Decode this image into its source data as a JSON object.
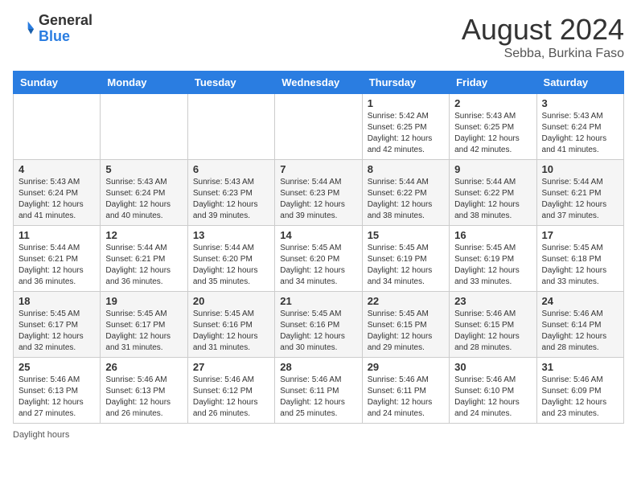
{
  "header": {
    "logo_general": "General",
    "logo_blue": "Blue",
    "month_title": "August 2024",
    "subtitle": "Sebba, Burkina Faso"
  },
  "weekdays": [
    "Sunday",
    "Monday",
    "Tuesday",
    "Wednesday",
    "Thursday",
    "Friday",
    "Saturday"
  ],
  "weeks": [
    [
      {
        "day": "",
        "info": ""
      },
      {
        "day": "",
        "info": ""
      },
      {
        "day": "",
        "info": ""
      },
      {
        "day": "",
        "info": ""
      },
      {
        "day": "1",
        "info": "Sunrise: 5:42 AM\nSunset: 6:25 PM\nDaylight: 12 hours and 42 minutes."
      },
      {
        "day": "2",
        "info": "Sunrise: 5:43 AM\nSunset: 6:25 PM\nDaylight: 12 hours and 42 minutes."
      },
      {
        "day": "3",
        "info": "Sunrise: 5:43 AM\nSunset: 6:24 PM\nDaylight: 12 hours and 41 minutes."
      }
    ],
    [
      {
        "day": "4",
        "info": "Sunrise: 5:43 AM\nSunset: 6:24 PM\nDaylight: 12 hours and 41 minutes."
      },
      {
        "day": "5",
        "info": "Sunrise: 5:43 AM\nSunset: 6:24 PM\nDaylight: 12 hours and 40 minutes."
      },
      {
        "day": "6",
        "info": "Sunrise: 5:43 AM\nSunset: 6:23 PM\nDaylight: 12 hours and 39 minutes."
      },
      {
        "day": "7",
        "info": "Sunrise: 5:44 AM\nSunset: 6:23 PM\nDaylight: 12 hours and 39 minutes."
      },
      {
        "day": "8",
        "info": "Sunrise: 5:44 AM\nSunset: 6:22 PM\nDaylight: 12 hours and 38 minutes."
      },
      {
        "day": "9",
        "info": "Sunrise: 5:44 AM\nSunset: 6:22 PM\nDaylight: 12 hours and 38 minutes."
      },
      {
        "day": "10",
        "info": "Sunrise: 5:44 AM\nSunset: 6:21 PM\nDaylight: 12 hours and 37 minutes."
      }
    ],
    [
      {
        "day": "11",
        "info": "Sunrise: 5:44 AM\nSunset: 6:21 PM\nDaylight: 12 hours and 36 minutes."
      },
      {
        "day": "12",
        "info": "Sunrise: 5:44 AM\nSunset: 6:21 PM\nDaylight: 12 hours and 36 minutes."
      },
      {
        "day": "13",
        "info": "Sunrise: 5:44 AM\nSunset: 6:20 PM\nDaylight: 12 hours and 35 minutes."
      },
      {
        "day": "14",
        "info": "Sunrise: 5:45 AM\nSunset: 6:20 PM\nDaylight: 12 hours and 34 minutes."
      },
      {
        "day": "15",
        "info": "Sunrise: 5:45 AM\nSunset: 6:19 PM\nDaylight: 12 hours and 34 minutes."
      },
      {
        "day": "16",
        "info": "Sunrise: 5:45 AM\nSunset: 6:19 PM\nDaylight: 12 hours and 33 minutes."
      },
      {
        "day": "17",
        "info": "Sunrise: 5:45 AM\nSunset: 6:18 PM\nDaylight: 12 hours and 33 minutes."
      }
    ],
    [
      {
        "day": "18",
        "info": "Sunrise: 5:45 AM\nSunset: 6:17 PM\nDaylight: 12 hours and 32 minutes."
      },
      {
        "day": "19",
        "info": "Sunrise: 5:45 AM\nSunset: 6:17 PM\nDaylight: 12 hours and 31 minutes."
      },
      {
        "day": "20",
        "info": "Sunrise: 5:45 AM\nSunset: 6:16 PM\nDaylight: 12 hours and 31 minutes."
      },
      {
        "day": "21",
        "info": "Sunrise: 5:45 AM\nSunset: 6:16 PM\nDaylight: 12 hours and 30 minutes."
      },
      {
        "day": "22",
        "info": "Sunrise: 5:45 AM\nSunset: 6:15 PM\nDaylight: 12 hours and 29 minutes."
      },
      {
        "day": "23",
        "info": "Sunrise: 5:46 AM\nSunset: 6:15 PM\nDaylight: 12 hours and 28 minutes."
      },
      {
        "day": "24",
        "info": "Sunrise: 5:46 AM\nSunset: 6:14 PM\nDaylight: 12 hours and 28 minutes."
      }
    ],
    [
      {
        "day": "25",
        "info": "Sunrise: 5:46 AM\nSunset: 6:13 PM\nDaylight: 12 hours and 27 minutes."
      },
      {
        "day": "26",
        "info": "Sunrise: 5:46 AM\nSunset: 6:13 PM\nDaylight: 12 hours and 26 minutes."
      },
      {
        "day": "27",
        "info": "Sunrise: 5:46 AM\nSunset: 6:12 PM\nDaylight: 12 hours and 26 minutes."
      },
      {
        "day": "28",
        "info": "Sunrise: 5:46 AM\nSunset: 6:11 PM\nDaylight: 12 hours and 25 minutes."
      },
      {
        "day": "29",
        "info": "Sunrise: 5:46 AM\nSunset: 6:11 PM\nDaylight: 12 hours and 24 minutes."
      },
      {
        "day": "30",
        "info": "Sunrise: 5:46 AM\nSunset: 6:10 PM\nDaylight: 12 hours and 24 minutes."
      },
      {
        "day": "31",
        "info": "Sunrise: 5:46 AM\nSunset: 6:09 PM\nDaylight: 12 hours and 23 minutes."
      }
    ]
  ],
  "footer": {
    "daylight_hours_label": "Daylight hours"
  }
}
